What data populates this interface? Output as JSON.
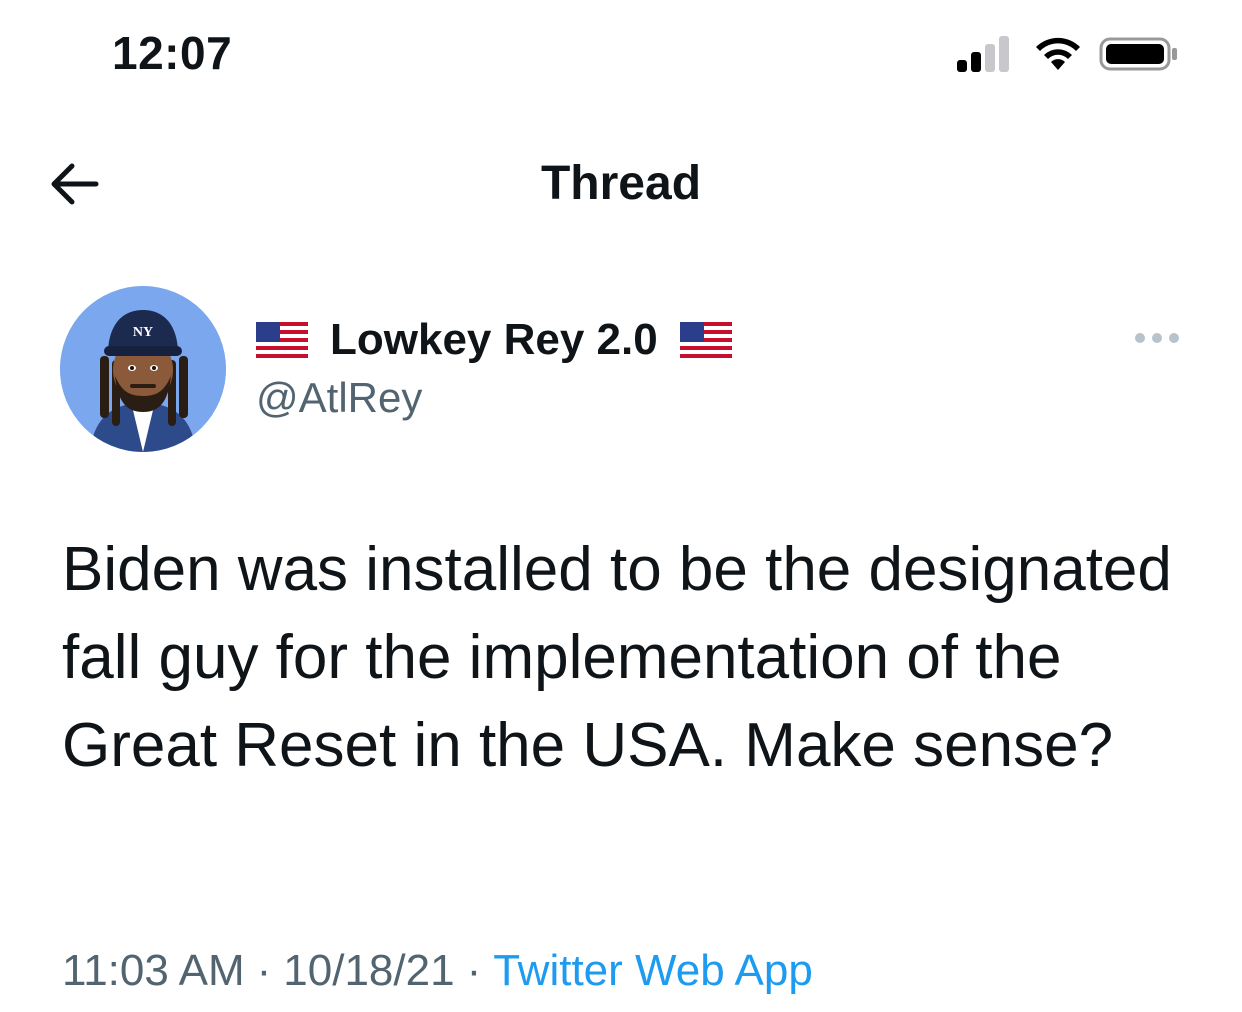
{
  "status_bar": {
    "time": "12:07",
    "icons": [
      "cellular-signal-icon",
      "wifi-icon",
      "battery-icon"
    ]
  },
  "header": {
    "back_icon": "arrow-left-icon",
    "title": "Thread"
  },
  "tweet": {
    "author": {
      "name": "Lowkey Rey 2.0",
      "handle": "@AtlRey",
      "name_prefix_emoji": "us-flag",
      "name_suffix_emoji": "us-flag"
    },
    "more_icon": "more-horizontal-icon",
    "text": "Biden was installed to be the designated fall guy for the implementation of the Great Reset in the USA. Make sense?",
    "time": "11:03 AM",
    "date": "10/18/21",
    "separator": "·",
    "source": "Twitter Web App"
  },
  "colors": {
    "text_primary": "#0f1419",
    "text_secondary": "#536471",
    "link": "#1d9bf0",
    "avatar_background": "#7aa7ee"
  }
}
